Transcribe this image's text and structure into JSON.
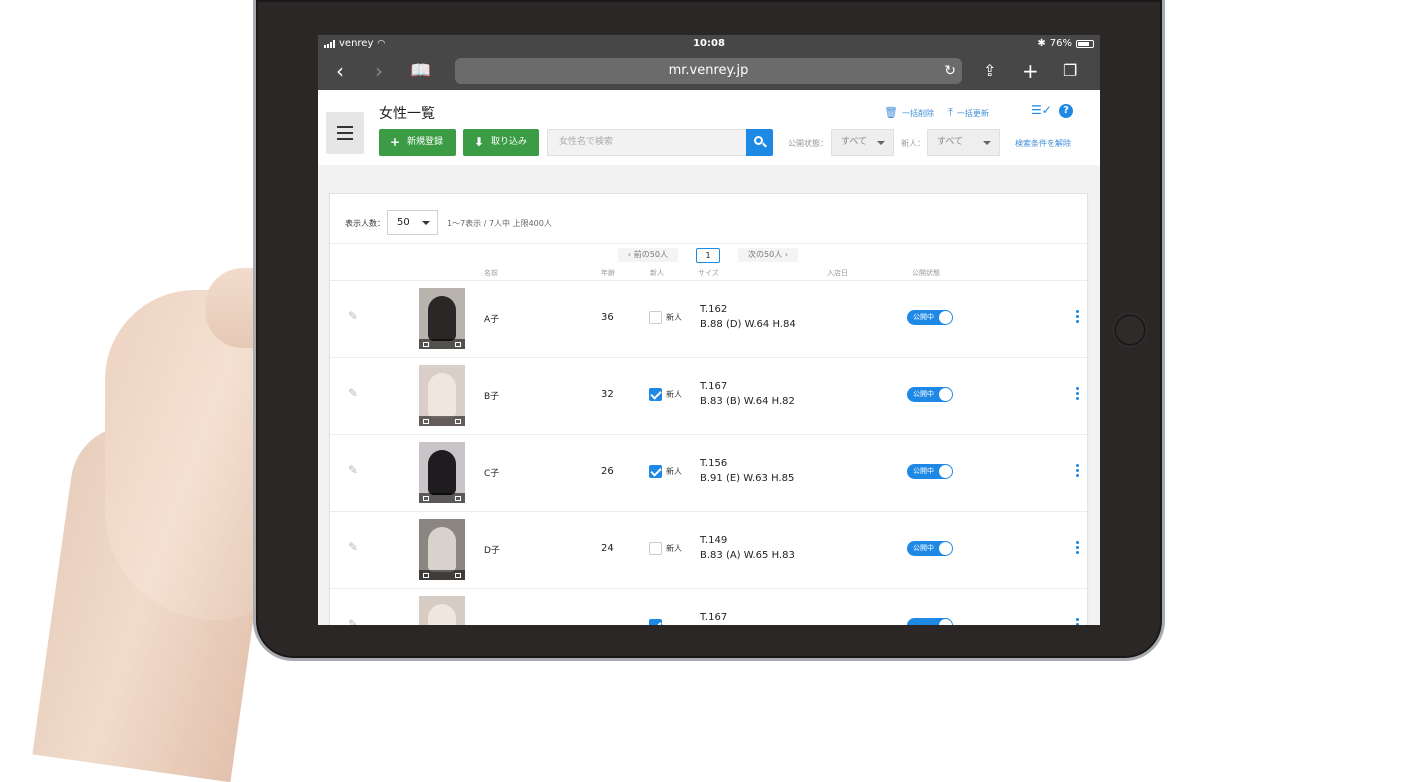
{
  "status": {
    "carrier": "venrey",
    "time": "10:08",
    "battery": "76%"
  },
  "browser": {
    "url": "mr.venrey.jp"
  },
  "header": {
    "title": "女性一覧",
    "new_button": "新規登録",
    "import_button": "取り込み",
    "search_placeholder": "女性名で検索",
    "status_filter_label": "公開状態：",
    "status_filter_value": "すべて",
    "new_filter_label": "新人：",
    "new_filter_value": "すべて",
    "clear_filters": "検索条件を解除",
    "bulk_delete": "一括削除",
    "bulk_update": "一括更新"
  },
  "list": {
    "per_page_label": "表示人数：",
    "per_page_value": "50",
    "range_text": "1〜7表示 / 7人中 上限400人",
    "prev_label": "前の50人",
    "next_label": "次の50人",
    "current_page": "1",
    "columns": {
      "name": "名前",
      "age": "年齢",
      "new": "新人",
      "size": "サイズ",
      "join_date": "入店日",
      "status": "公開状態"
    },
    "new_label": "新人",
    "rows": [
      {
        "name": "A子",
        "age": "36",
        "is_new": false,
        "height": "T.162",
        "measure": "B.88 (D) W.64 H.84",
        "status": "公開中"
      },
      {
        "name": "B子",
        "age": "32",
        "is_new": true,
        "height": "T.167",
        "measure": "B.83 (B) W.64 H.82",
        "status": "公開中"
      },
      {
        "name": "C子",
        "age": "26",
        "is_new": true,
        "height": "T.156",
        "measure": "B.91 (E) W.63 H.85",
        "status": "公開中"
      },
      {
        "name": "D子",
        "age": "24",
        "is_new": false,
        "height": "T.149",
        "measure": "B.83 (A) W.65 H.83",
        "status": "公開中"
      },
      {
        "name": "",
        "age": "",
        "is_new": true,
        "height": "T.167",
        "measure": "",
        "status": ""
      }
    ]
  },
  "colors": {
    "primary_blue": "#1e88e5",
    "green": "#3b9c45",
    "bar_gray": "#474747"
  }
}
